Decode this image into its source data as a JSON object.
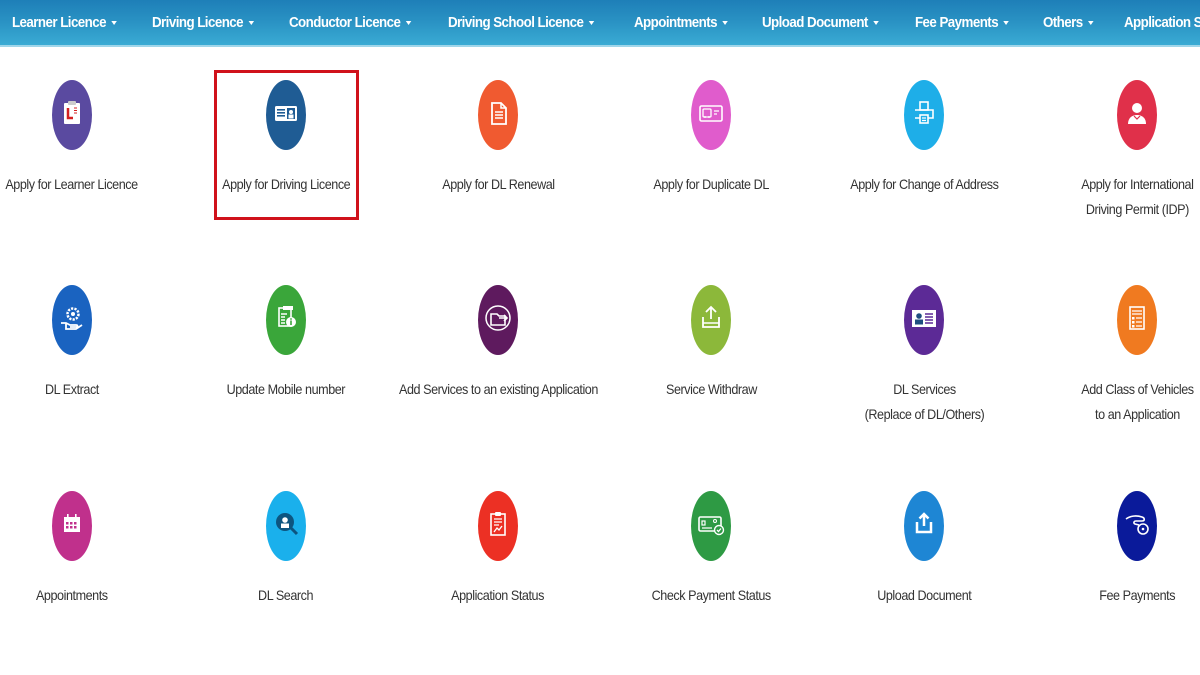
{
  "navbar": {
    "items": [
      {
        "label": "Learner Licence",
        "has_dropdown": true
      },
      {
        "label": "Driving Licence",
        "has_dropdown": true
      },
      {
        "label": "Conductor Licence",
        "has_dropdown": true
      },
      {
        "label": "Driving School Licence",
        "has_dropdown": true
      },
      {
        "label": "Appointments",
        "has_dropdown": true
      },
      {
        "label": "Upload Document",
        "has_dropdown": true
      },
      {
        "label": "Fee Payments",
        "has_dropdown": true
      },
      {
        "label": "Others",
        "has_dropdown": true
      },
      {
        "label": "Application Status",
        "has_dropdown": false
      }
    ]
  },
  "services": [
    {
      "line1": "Apply for Learner Licence",
      "line2": "",
      "icon": "learner-licence-icon",
      "color": "#5a4aa0",
      "selected": false
    },
    {
      "line1": "Apply for Driving Licence",
      "line2": "",
      "icon": "driving-licence-card-icon",
      "color": "#1f5c94",
      "selected": true
    },
    {
      "line1": "Apply for DL Renewal",
      "line2": "",
      "icon": "document-icon",
      "color": "#f05a30",
      "selected": false
    },
    {
      "line1": "Apply for Duplicate DL",
      "line2": "",
      "icon": "duplicate-card-icon",
      "color": "#e05ccc",
      "selected": false
    },
    {
      "line1": "Apply for Change of Address",
      "line2": "",
      "icon": "printer-icon",
      "color": "#1eaee8",
      "selected": false
    },
    {
      "line1": "Apply for International",
      "line2": "Driving Permit (IDP)",
      "icon": "person-icon",
      "color": "#e0304a",
      "selected": false
    },
    {
      "line1": "DL Extract",
      "line2": "",
      "icon": "gear-hand-icon",
      "color": "#1a63c0",
      "selected": false
    },
    {
      "line1": "Update Mobile number",
      "line2": "",
      "icon": "info-document-icon",
      "color": "#3aa63a",
      "selected": false
    },
    {
      "line1": "Add Services to an existing Application",
      "line2": "",
      "icon": "folder-arrow-icon",
      "color": "#5e1a5e",
      "selected": false
    },
    {
      "line1": "Service Withdraw",
      "line2": "",
      "icon": "upload-tray-icon",
      "color": "#8cb83a",
      "selected": false
    },
    {
      "line1": "DL Services",
      "line2": "(Replace of DL/Others)",
      "icon": "id-card-icon",
      "color": "#5c2a96",
      "selected": false
    },
    {
      "line1": "Add Class of Vehicles",
      "line2": "to an Application",
      "icon": "checklist-icon",
      "color": "#f07a20",
      "selected": false
    },
    {
      "line1": "Appointments",
      "line2": "",
      "icon": "calendar-icon",
      "color": "#c0308c",
      "selected": false
    },
    {
      "line1": "DL Search",
      "line2": "",
      "icon": "search-person-icon",
      "color": "#1ab0ec",
      "selected": false
    },
    {
      "line1": "Application Status",
      "line2": "",
      "icon": "clipboard-chart-icon",
      "color": "#ec3024",
      "selected": false
    },
    {
      "line1": "Check Payment Status",
      "line2": "",
      "icon": "payment-card-check-icon",
      "color": "#2e9a44",
      "selected": false
    },
    {
      "line1": "Upload Document",
      "line2": "",
      "icon": "upload-icon",
      "color": "#1e86d4",
      "selected": false
    },
    {
      "line1": "Fee Payments",
      "line2": "",
      "icon": "hand-coin-icon",
      "color": "#0a1a9a",
      "selected": false
    }
  ],
  "highlight_color": "#d0121b"
}
